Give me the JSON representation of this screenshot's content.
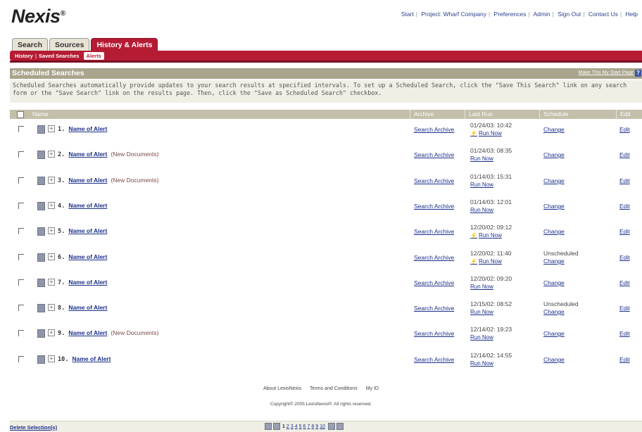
{
  "logo": "Nexis",
  "logo_mark": "®",
  "topnav": [
    "Start",
    "Project: Wharf Company",
    "Preferences",
    "Admin",
    "Sign Out",
    "Contact Us",
    "Help"
  ],
  "tabs": [
    {
      "label": "Search",
      "active": false
    },
    {
      "label": "Sources",
      "active": false
    },
    {
      "label": "History & Alerts",
      "active": true
    }
  ],
  "subtabs": [
    {
      "label": "History",
      "active": false
    },
    {
      "label": "Saved Searches",
      "active": false
    },
    {
      "label": "Alerts",
      "active": true
    }
  ],
  "section": {
    "title": "Scheduled Searches",
    "start_page_link": "Make This My Start Page",
    "help_icon": "?",
    "description_line1": "Scheduled Searches automatically provide updates to your search results at specified intervals. To set up a Scheduled Search, click the \"Save This Search\" link on any search",
    "description_line2": "form or the \"Save Search\" link on the results page. Then, click the \"Save as Scheduled Search\" checkbox."
  },
  "table": {
    "headers": {
      "name": "Name",
      "archive": "Archive",
      "last_run": "Last Run",
      "schedule": "Schedule",
      "edit": "Edit"
    },
    "rows": [
      {
        "num": "1.",
        "name": "Name of Alert",
        "new_docs": "",
        "archive": "Search Archive",
        "last_run": "01/24/03: 10:42",
        "run_now": "Run Now",
        "bolt": true,
        "unscheduled": "",
        "schedule": "Change",
        "edit": "Edit"
      },
      {
        "num": "2.",
        "name": "Name of Alert",
        "new_docs": "(New Documents)",
        "archive": "Search Archive",
        "last_run": "01/24/03: 08:35",
        "run_now": "Run Now",
        "bolt": false,
        "unscheduled": "",
        "schedule": "Change",
        "edit": "Edit"
      },
      {
        "num": "3.",
        "name": "Name of Alert",
        "new_docs": "(New Documents)",
        "archive": "Search Archive",
        "last_run": "01/14/03: 15:31",
        "run_now": "Run Now",
        "bolt": false,
        "unscheduled": "",
        "schedule": "Change",
        "edit": "Edit"
      },
      {
        "num": "4.",
        "name": "Name of Alert",
        "new_docs": "",
        "archive": "Search Archive",
        "last_run": "01/14/03: 12:01",
        "run_now": "Run Now",
        "bolt": false,
        "unscheduled": "",
        "schedule": "Change",
        "edit": "Edit"
      },
      {
        "num": "5.",
        "name": "Name of Alert",
        "new_docs": "",
        "archive": "Search Archive",
        "last_run": "12/20/02: 09:12",
        "run_now": "Run Now",
        "bolt": true,
        "unscheduled": "",
        "schedule": "Change",
        "edit": "Edit"
      },
      {
        "num": "6.",
        "name": "Name of Alert",
        "new_docs": "",
        "archive": "Search Archive",
        "last_run": "12/20/02: 11:40",
        "run_now": "Run Now",
        "bolt": true,
        "unscheduled": "Unscheduled",
        "schedule": "Change",
        "edit": "Edit"
      },
      {
        "num": "7.",
        "name": "Name of Alert",
        "new_docs": "",
        "archive": "Search Archive",
        "last_run": "12/20/02: 09:20",
        "run_now": "Run Now",
        "bolt": false,
        "unscheduled": "",
        "schedule": "Change",
        "edit": "Edit"
      },
      {
        "num": "8.",
        "name": "Name of Alert",
        "new_docs": "",
        "archive": "Search Archive",
        "last_run": "12/15/02: 08:52",
        "run_now": "Run Now",
        "bolt": false,
        "unscheduled": "Unscheduled",
        "schedule": "Change",
        "edit": "Edit"
      },
      {
        "num": "9.",
        "name": "Name of Alert",
        "new_docs": "(New Documents)",
        "archive": "Search Archive",
        "last_run": "12/14/02: 19:23",
        "run_now": "Run Now",
        "bolt": false,
        "unscheduled": "",
        "schedule": "Change",
        "edit": "Edit"
      },
      {
        "num": "10.",
        "name": "Name of Alert",
        "new_docs": "",
        "archive": "Search Archive",
        "last_run": "12/14/02: 14:55",
        "run_now": "Run Now",
        "bolt": false,
        "unscheduled": "",
        "schedule": "Change",
        "edit": "Edit"
      }
    ]
  },
  "footer": {
    "links": [
      "About LexisNexis",
      "Terms and Conditions",
      "My ID"
    ],
    "copyright": "Copyright© 2005 LexisNexis®. All rights reserved."
  },
  "bottom": {
    "delete_selection": "Delete Selection(s)",
    "pages": [
      "1",
      "2",
      "3",
      "4",
      "5",
      "6",
      "7",
      "8",
      "9",
      "10"
    ],
    "current_page": "1"
  },
  "colors": {
    "accent": "#b51c34",
    "header_band": "#a9a48c",
    "link": "#1a2f8a"
  }
}
